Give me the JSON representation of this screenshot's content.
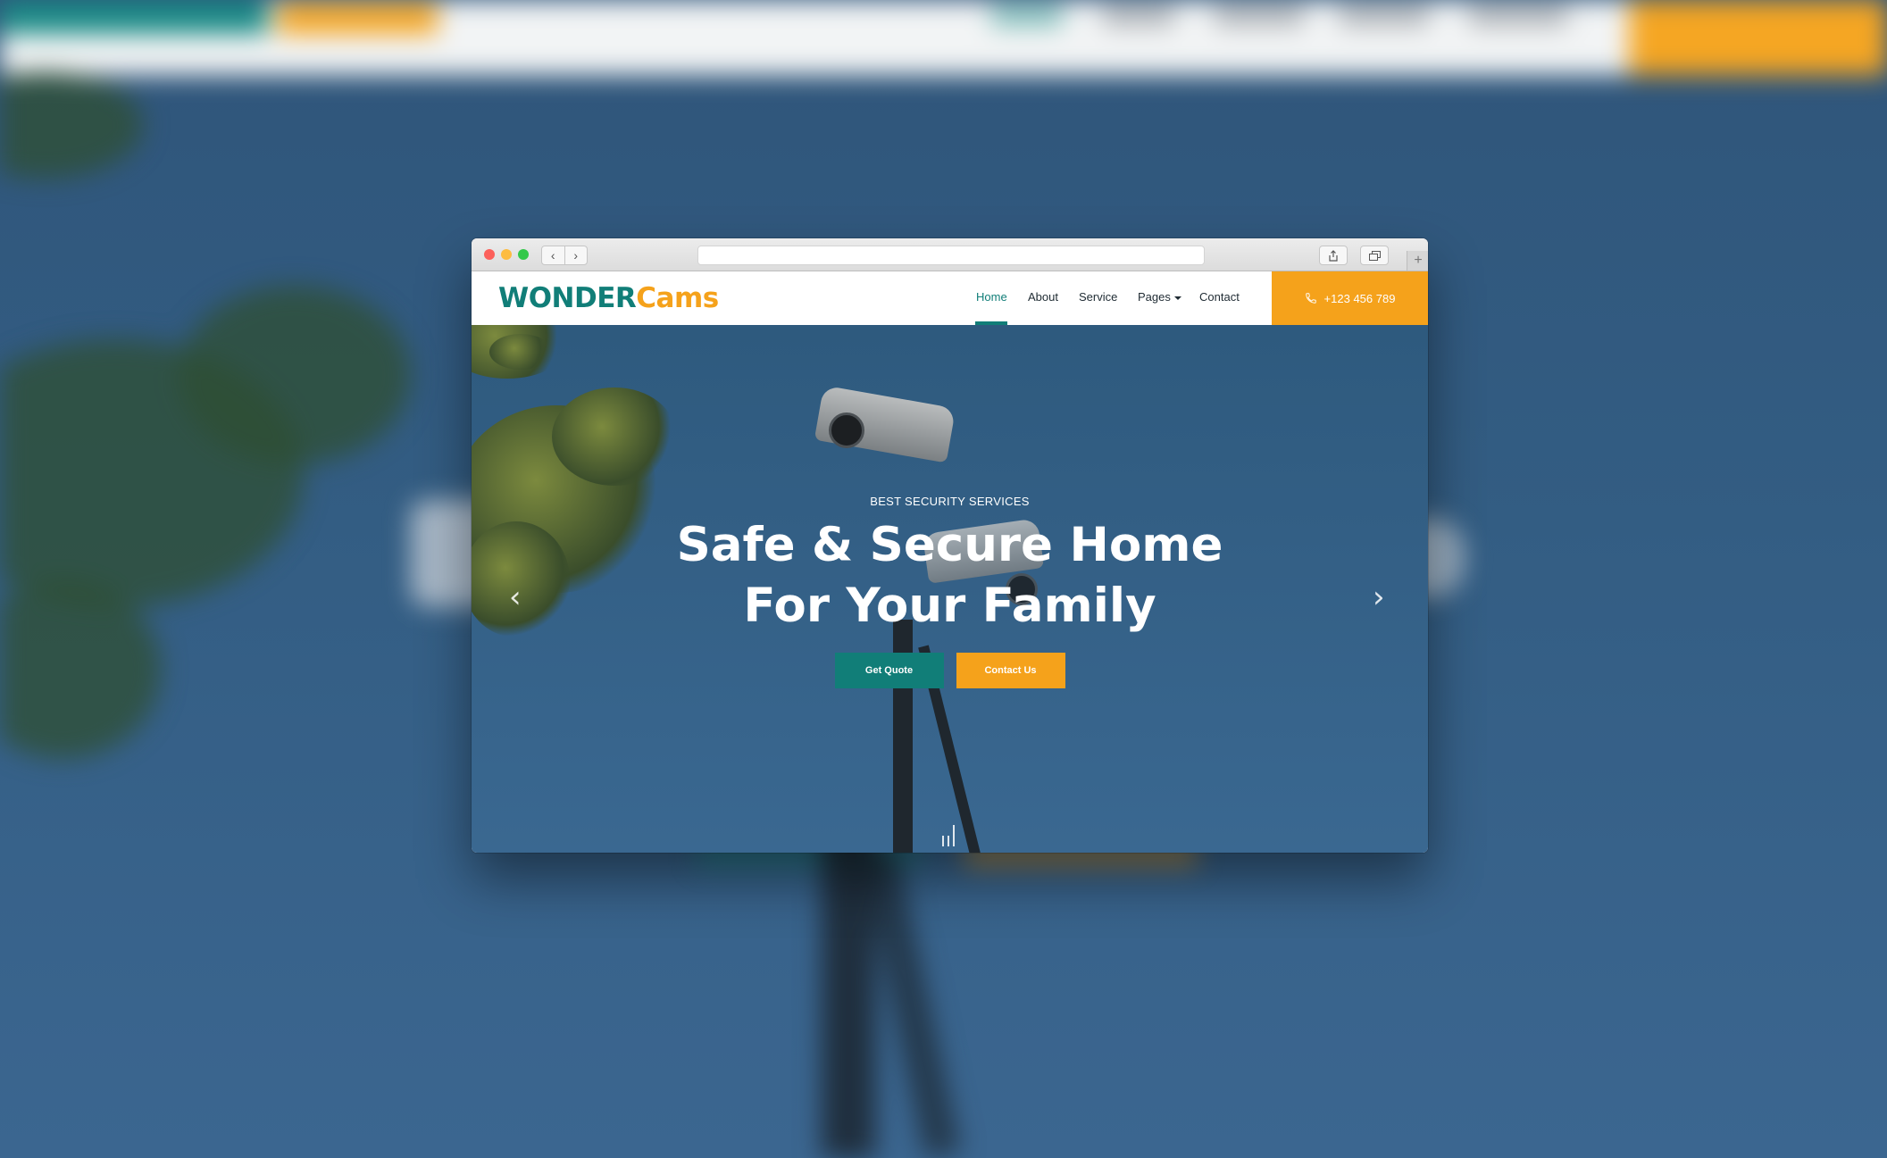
{
  "brand": {
    "part1": "WONDER",
    "part2": "Cams"
  },
  "nav": {
    "home": "Home",
    "about": "About",
    "service": "Service",
    "pages": "Pages",
    "contact": "Contact"
  },
  "header": {
    "phone": "+123 456 789",
    "phone_icon": "phone-icon"
  },
  "hero": {
    "eyebrow": "BEST SECURITY SERVICES",
    "title_line1": "Safe & Secure Home",
    "title_line2": "For Your Family",
    "primary_button": "Get Quote",
    "secondary_button": "Contact Us"
  },
  "browser": {
    "back_glyph": "‹",
    "forward_glyph": "›",
    "new_tab_glyph": "+"
  },
  "carousel": {
    "prev_glyph": "‹",
    "next_glyph": "›"
  },
  "colors": {
    "teal": "#117e78",
    "orange": "#f5a21b",
    "hero_blue": "#335f85"
  }
}
